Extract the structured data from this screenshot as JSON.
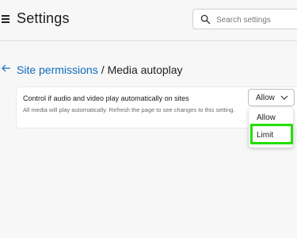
{
  "header": {
    "title": "Settings",
    "search_placeholder": "Search settings"
  },
  "breadcrumb": {
    "parent": "Site permissions",
    "separator": "/",
    "current": "Media autoplay"
  },
  "setting": {
    "label": "Control if audio and video play automatically on sites",
    "description": "All media will play automatically. Refresh the page to see changes to this setting."
  },
  "dropdown": {
    "selected": "Allow",
    "options": [
      "Allow",
      "Limit"
    ]
  },
  "colors": {
    "link": "#0f6cbd",
    "highlight": "#22e000",
    "background": "#f7f7f7"
  }
}
